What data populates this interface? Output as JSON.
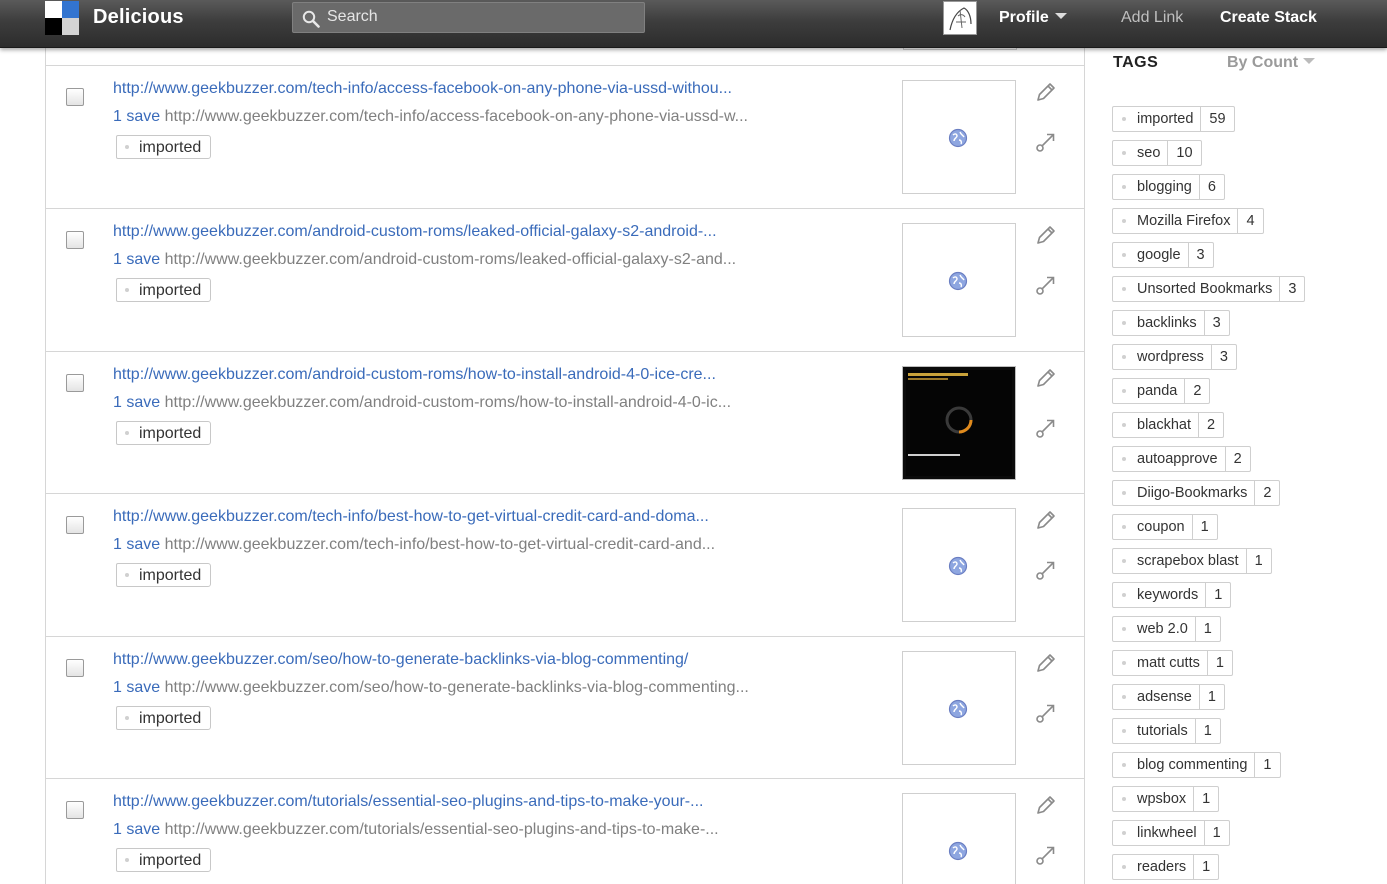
{
  "app": {
    "brand": "Delicious",
    "search_placeholder": "Search",
    "nav": {
      "profile": "Profile",
      "add_link": "Add Link",
      "create_stack": "Create Stack"
    }
  },
  "colors": {
    "link": "#3a6bba",
    "topbar": "#3d3d3d"
  },
  "bookmarks": [
    {
      "title": "http://www.geekbuzzer.com/tech-info/access-facebook-on-any-phone-via-ussd-withou...",
      "saves": "1 save",
      "url": "http://www.geekbuzzer.com/tech-info/access-facebook-on-any-phone-via-ussd-w...",
      "tag": "imported",
      "thumb": "globe-icon"
    },
    {
      "title": "http://www.geekbuzzer.com/android-custom-roms/leaked-official-galaxy-s2-android-...",
      "saves": "1 save",
      "url": "http://www.geekbuzzer.com/android-custom-roms/leaked-official-galaxy-s2-and...",
      "tag": "imported",
      "thumb": "globe-icon"
    },
    {
      "title": "http://www.geekbuzzer.com/android-custom-roms/how-to-install-android-4-0-ice-cre...",
      "saves": "1 save",
      "url": "http://www.geekbuzzer.com/android-custom-roms/how-to-install-android-4-0-ic...",
      "tag": "imported",
      "thumb": "screenshot-thumbnail"
    },
    {
      "title": "http://www.geekbuzzer.com/tech-info/best-how-to-get-virtual-credit-card-and-doma...",
      "saves": "1 save",
      "url": "http://www.geekbuzzer.com/tech-info/best-how-to-get-virtual-credit-card-and...",
      "tag": "imported",
      "thumb": "globe-icon"
    },
    {
      "title": "http://www.geekbuzzer.com/seo/how-to-generate-backlinks-via-blog-commenting/",
      "saves": "1 save",
      "url": "http://www.geekbuzzer.com/seo/how-to-generate-backlinks-via-blog-commenting...",
      "tag": "imported",
      "thumb": "globe-icon"
    },
    {
      "title": "http://www.geekbuzzer.com/tutorials/essential-seo-plugins-and-tips-to-make-your-...",
      "saves": "1 save",
      "url": "http://www.geekbuzzer.com/tutorials/essential-seo-plugins-and-tips-to-make-...",
      "tag": "imported",
      "thumb": "globe-icon"
    }
  ],
  "sidebar": {
    "title": "TAGS",
    "sort": "By Count",
    "tags": [
      {
        "name": "imported",
        "count": "59"
      },
      {
        "name": "seo",
        "count": "10"
      },
      {
        "name": "blogging",
        "count": "6"
      },
      {
        "name": "Mozilla Firefox",
        "count": "4"
      },
      {
        "name": "google",
        "count": "3"
      },
      {
        "name": "Unsorted Bookmarks",
        "count": "3"
      },
      {
        "name": "backlinks",
        "count": "3"
      },
      {
        "name": "wordpress",
        "count": "3"
      },
      {
        "name": "panda",
        "count": "2"
      },
      {
        "name": "blackhat",
        "count": "2"
      },
      {
        "name": "autoapprove",
        "count": "2"
      },
      {
        "name": "Diigo-Bookmarks",
        "count": "2"
      },
      {
        "name": "coupon",
        "count": "1"
      },
      {
        "name": "scrapebox blast",
        "count": "1"
      },
      {
        "name": "keywords",
        "count": "1"
      },
      {
        "name": "web 2.0",
        "count": "1"
      },
      {
        "name": "matt cutts",
        "count": "1"
      },
      {
        "name": "adsense",
        "count": "1"
      },
      {
        "name": "tutorials",
        "count": "1"
      },
      {
        "name": "blog commenting",
        "count": "1"
      },
      {
        "name": "wpsbox",
        "count": "1"
      },
      {
        "name": "linkwheel",
        "count": "1"
      },
      {
        "name": "readers",
        "count": "1"
      }
    ]
  }
}
